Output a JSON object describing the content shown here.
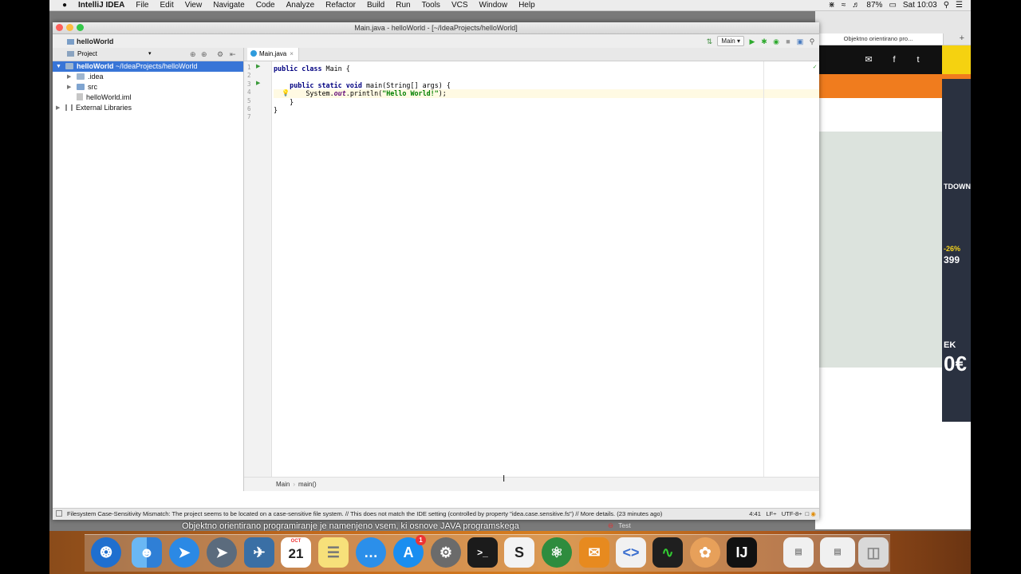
{
  "menubar": {
    "app_name": "IntelliJ IDEA",
    "items": [
      "File",
      "Edit",
      "View",
      "Navigate",
      "Code",
      "Analyze",
      "Refactor",
      "Build",
      "Run",
      "Tools",
      "VCS",
      "Window",
      "Help"
    ],
    "battery": "87%",
    "clock": "Sat 10:03"
  },
  "browser": {
    "tab_title": "Objektno orientirano pro...",
    "ad_text_1": "TDOWN",
    "ad_text_2": "-26%",
    "ad_text_3": "399",
    "ad_text_4": "EK",
    "ad_text_5": "0€"
  },
  "ide": {
    "window_title": "Main.java - helloWorld - [~/IdeaProjects/helloWorld]",
    "nav_crumb": "helloWorld",
    "run_config": "Main",
    "project_panel": {
      "title": "Project",
      "tree": [
        {
          "name": "helloWorld",
          "path": "~/IdeaProjects/helloWorld"
        },
        {
          "name": ".idea"
        },
        {
          "name": "src"
        },
        {
          "name": "helloWorld.iml"
        },
        {
          "name": "External Libraries"
        }
      ]
    },
    "editor": {
      "tab": "Main.java",
      "line_numbers": [
        "1",
        "2",
        "3",
        "4",
        "5",
        "6",
        "7"
      ],
      "code": {
        "l1_kw": "public class",
        "l1_rest": " Main {",
        "l3_kw": "public static void",
        "l3_rest": " main(String[] args) {",
        "l4_pre": "System.",
        "l4_field": "out",
        "l4_mid": ".println(",
        "l4_str": "\"Hello World!\"",
        "l4_end": ");",
        "l5": "}",
        "l6": "}"
      },
      "breadcrumb": [
        "Main",
        "main()"
      ]
    },
    "status": {
      "message": "Filesystem Case-Sensitivity Mismatch: The project seems to be located on a case-sensitive file system. // This does not match the IDE setting (controlled by property \"idea.case.sensitive.fs\") // More details. (23 minutes ago)",
      "position": "4:41",
      "line_sep": "LF÷",
      "encoding": "UTF-8÷"
    }
  },
  "overlay": {
    "subtitle": "Objektno orientirano programiranje je namenjeno vsem, ki osnove JAVA programskega",
    "test_label": "Test"
  },
  "dock": {
    "calendar_month": "OCT",
    "calendar_day": "21",
    "appstore_badge": "1"
  }
}
